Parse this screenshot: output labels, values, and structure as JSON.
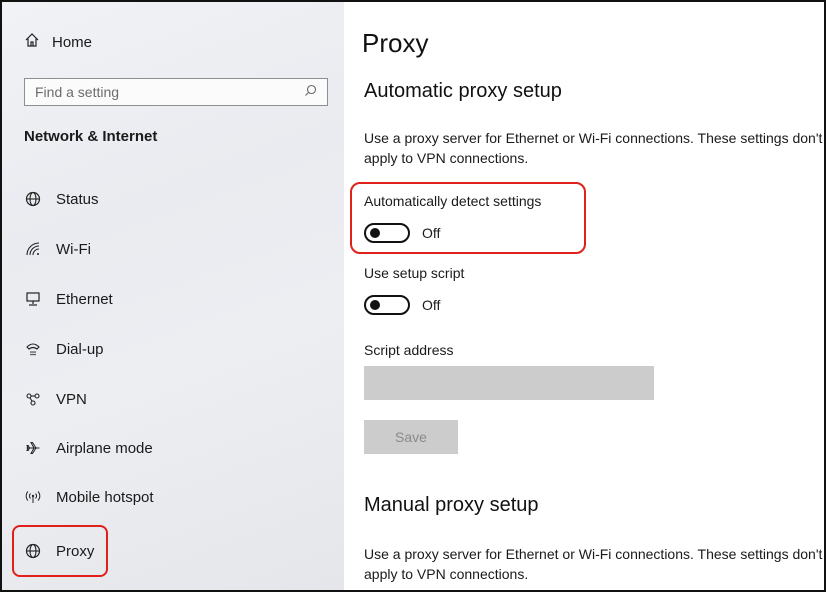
{
  "sidebar": {
    "home_label": "Home",
    "search_placeholder": "Find a setting",
    "section_title": "Network & Internet",
    "items": [
      {
        "label": "Status",
        "icon": "globe-status-icon"
      },
      {
        "label": "Wi-Fi",
        "icon": "wifi-icon"
      },
      {
        "label": "Ethernet",
        "icon": "ethernet-icon"
      },
      {
        "label": "Dial-up",
        "icon": "dialup-icon"
      },
      {
        "label": "VPN",
        "icon": "vpn-icon"
      },
      {
        "label": "Airplane mode",
        "icon": "airplane-icon"
      },
      {
        "label": "Mobile hotspot",
        "icon": "hotspot-icon"
      },
      {
        "label": "Proxy",
        "icon": "globe-icon",
        "selected": true
      }
    ]
  },
  "main": {
    "title": "Proxy",
    "auto": {
      "heading": "Automatic proxy setup",
      "description": "Use a proxy server for Ethernet or Wi-Fi connections. These settings don't apply to VPN connections.",
      "detect_label": "Automatically detect settings",
      "detect_state": "Off",
      "script_label": "Use setup script",
      "script_state": "Off",
      "address_label": "Script address",
      "address_value": "",
      "save_label": "Save"
    },
    "manual": {
      "heading": "Manual proxy setup",
      "description": "Use a proxy server for Ethernet or Wi-Fi connections. These settings don't apply to VPN connections."
    }
  },
  "colors": {
    "highlight": "#e0201b",
    "disabled_fill": "#cccccc"
  }
}
